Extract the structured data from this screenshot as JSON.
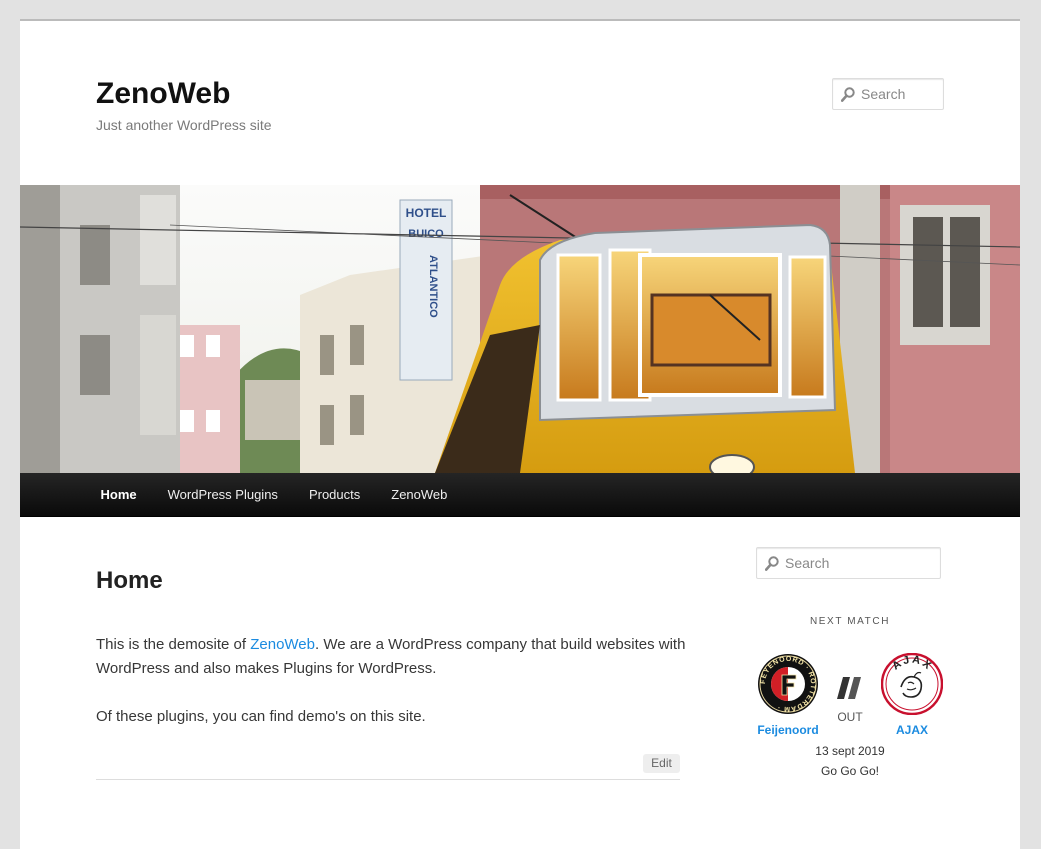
{
  "site": {
    "title": "ZenoWeb",
    "description": "Just another WordPress site"
  },
  "header_search": {
    "placeholder": "Search"
  },
  "nav": {
    "items": [
      {
        "label": "Home",
        "current": true
      },
      {
        "label": "WordPress Plugins"
      },
      {
        "label": "Products"
      },
      {
        "label": "ZenoWeb"
      }
    ]
  },
  "entry": {
    "title": "Home",
    "p1_before": "This is the demosite of ",
    "p1_link": "ZenoWeb",
    "p1_after": ". We are a WordPress company that build websites with WordPress and also makes Plugins for WordPress.",
    "p2": "Of these plugins, you can find demo's on this site.",
    "edit_label": "Edit"
  },
  "sidebar": {
    "search": {
      "placeholder": "Search"
    },
    "widget_title": "NEXT MATCH",
    "match": {
      "home_team": "Feijenoord",
      "away_team": "AJAX",
      "venue_label": "OUT",
      "date": "13 sept 2019",
      "note": "Go Go Go!",
      "home_logo_text": "FEYENOORD · ROTTERDAM ·",
      "away_logo_text": "AJAX"
    }
  },
  "colors": {
    "link": "#1b8be0",
    "nav_bg": "#111111",
    "page_bg": "#e2e2e2",
    "tram_yellow": "#e9b21a"
  },
  "banner": {
    "hotel_sign": "HOTEL BUICO",
    "hotel_sign_vertical": "ATLANTICO"
  }
}
